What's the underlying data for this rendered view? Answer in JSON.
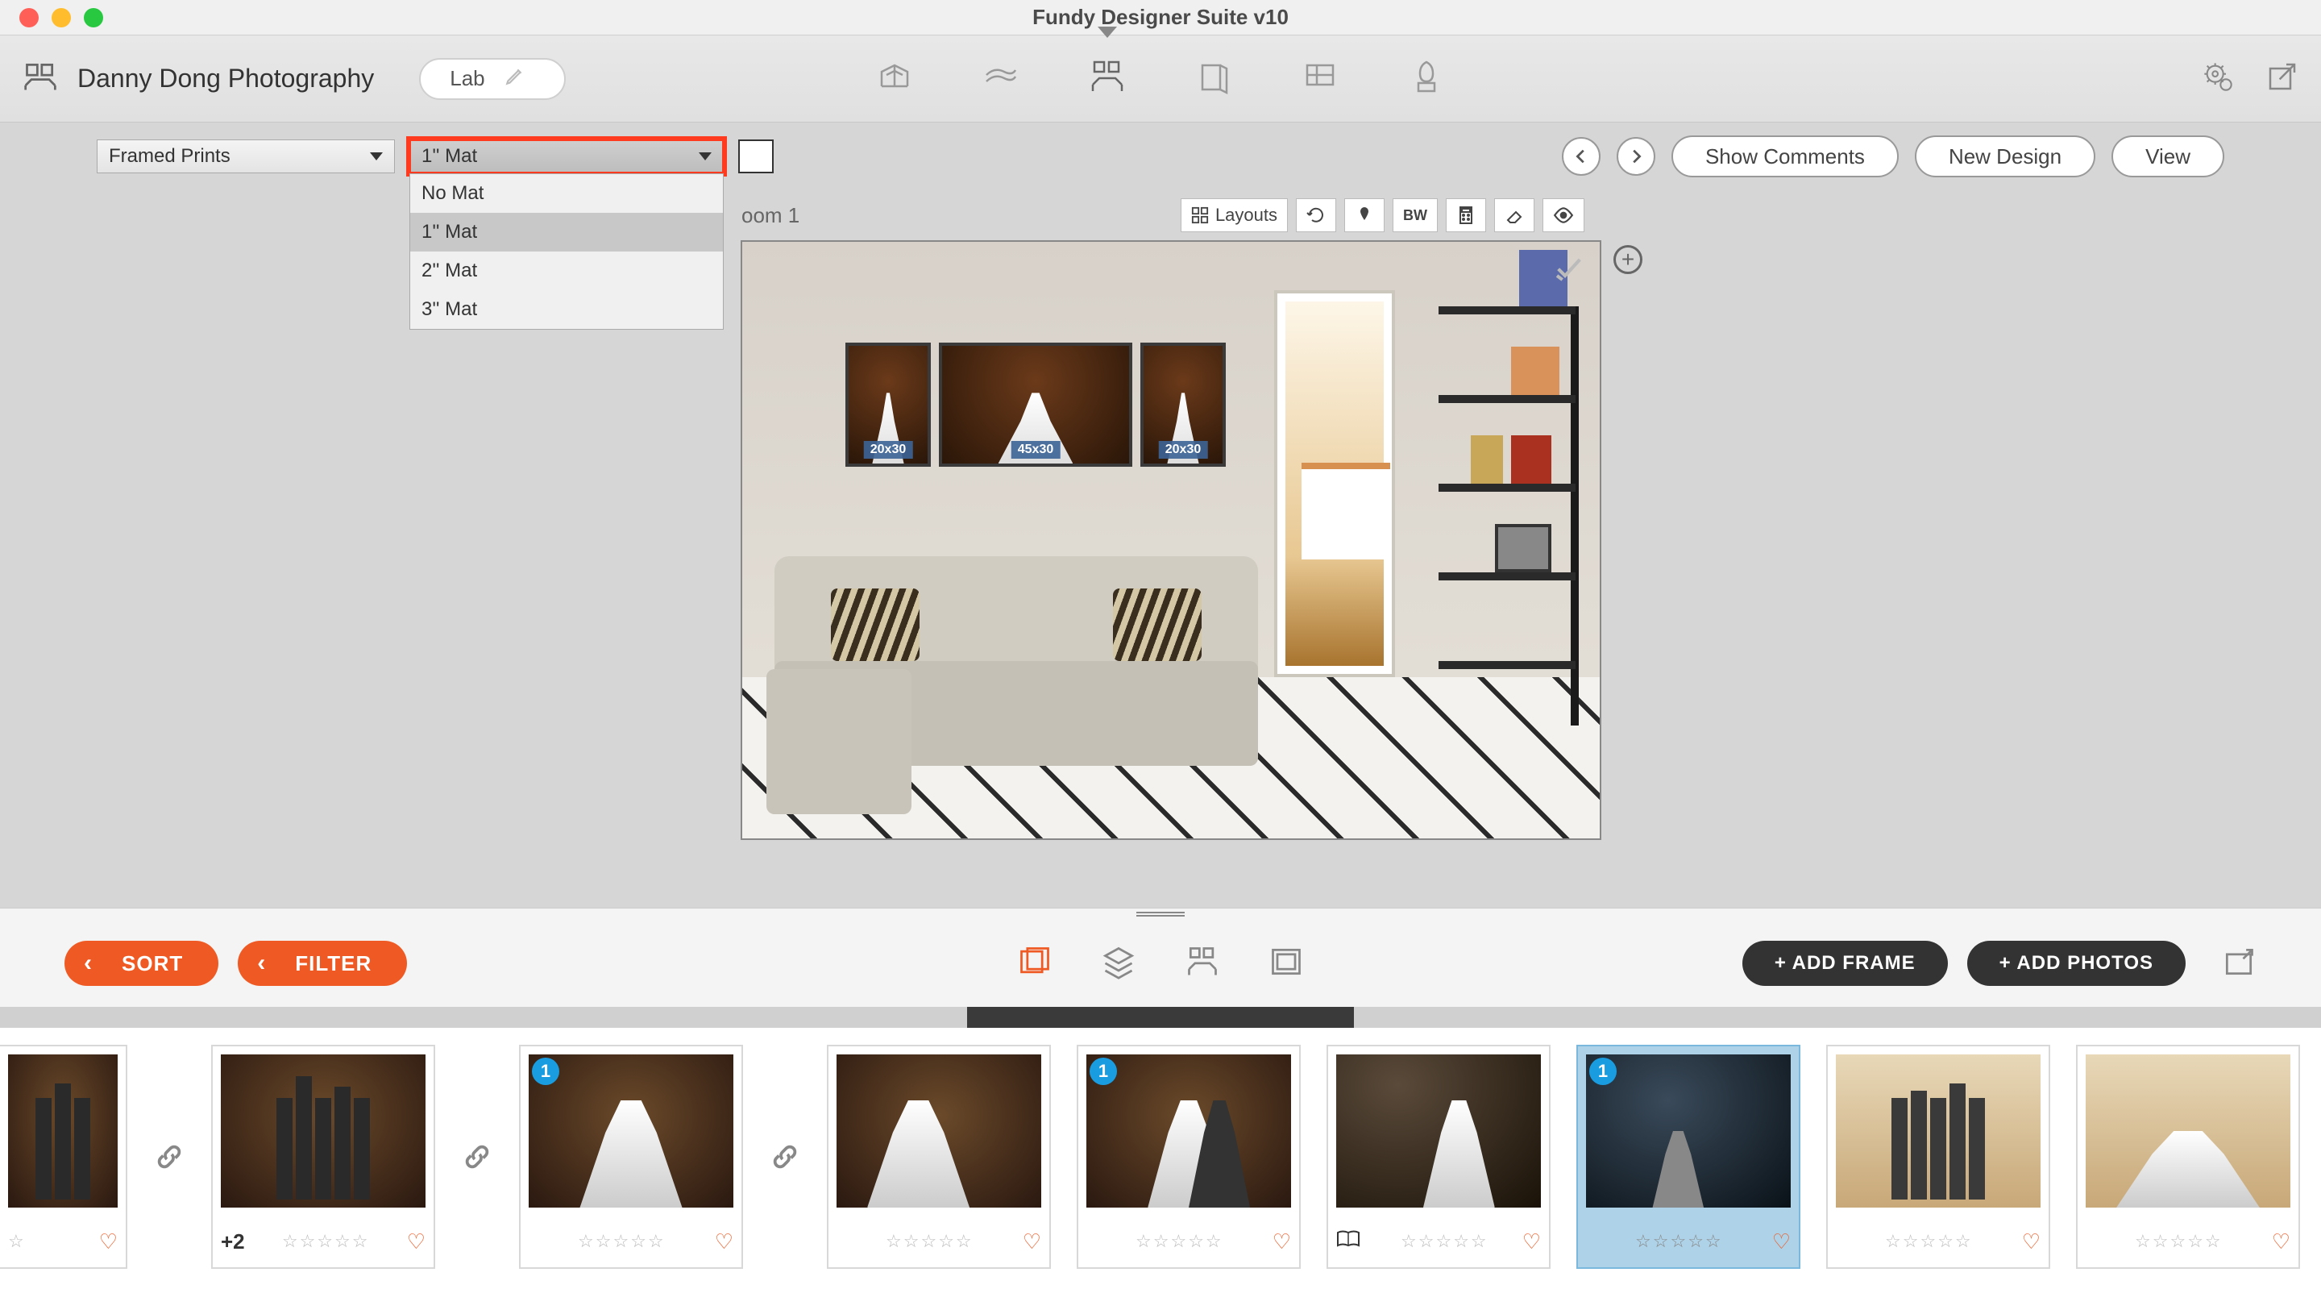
{
  "window": {
    "title": "Fundy Designer Suite v10"
  },
  "toolbar": {
    "project_name": "Danny Dong Photography",
    "lab_label": "Lab"
  },
  "controls": {
    "print_type": "Framed Prints",
    "mat_selected": "1'' Mat",
    "mat_options": [
      "No Mat",
      "1'' Mat",
      "2'' Mat",
      "3'' Mat"
    ],
    "show_comments": "Show Comments",
    "new_design": "New Design",
    "view": "View"
  },
  "canvas": {
    "room_label": "oom 1",
    "layouts_label": "Layouts",
    "bw_label": "BW",
    "frames": [
      {
        "size": "20x30"
      },
      {
        "size": "45x30"
      },
      {
        "size": "20x30"
      }
    ]
  },
  "bottom": {
    "sort": "SORT",
    "filter": "FILTER",
    "add_frame": "+ ADD FRAME",
    "add_photos": "+ ADD PHOTOS"
  },
  "thumbnails": [
    {
      "badge": null,
      "extra": null,
      "linked": true,
      "style": "group",
      "book": false
    },
    {
      "badge": null,
      "extra": "+2",
      "linked": true,
      "style": "group",
      "book": false
    },
    {
      "badge": "1",
      "extra": null,
      "linked": true,
      "style": "bride",
      "book": false
    },
    {
      "badge": null,
      "extra": null,
      "linked": false,
      "style": "bride2",
      "book": false
    },
    {
      "badge": "1",
      "extra": null,
      "linked": false,
      "style": "couple",
      "book": false
    },
    {
      "badge": null,
      "extra": null,
      "linked": false,
      "style": "stairs",
      "book": true
    },
    {
      "badge": "1",
      "extra": null,
      "linked": false,
      "style": "dark",
      "book": false,
      "selected": true
    },
    {
      "badge": null,
      "extra": null,
      "linked": false,
      "style": "arch-group",
      "book": false
    },
    {
      "badge": null,
      "extra": null,
      "linked": false,
      "style": "arch-bride",
      "book": false
    },
    {
      "badge": null,
      "extra": null,
      "linked": false,
      "style": "garden",
      "book": false
    }
  ]
}
